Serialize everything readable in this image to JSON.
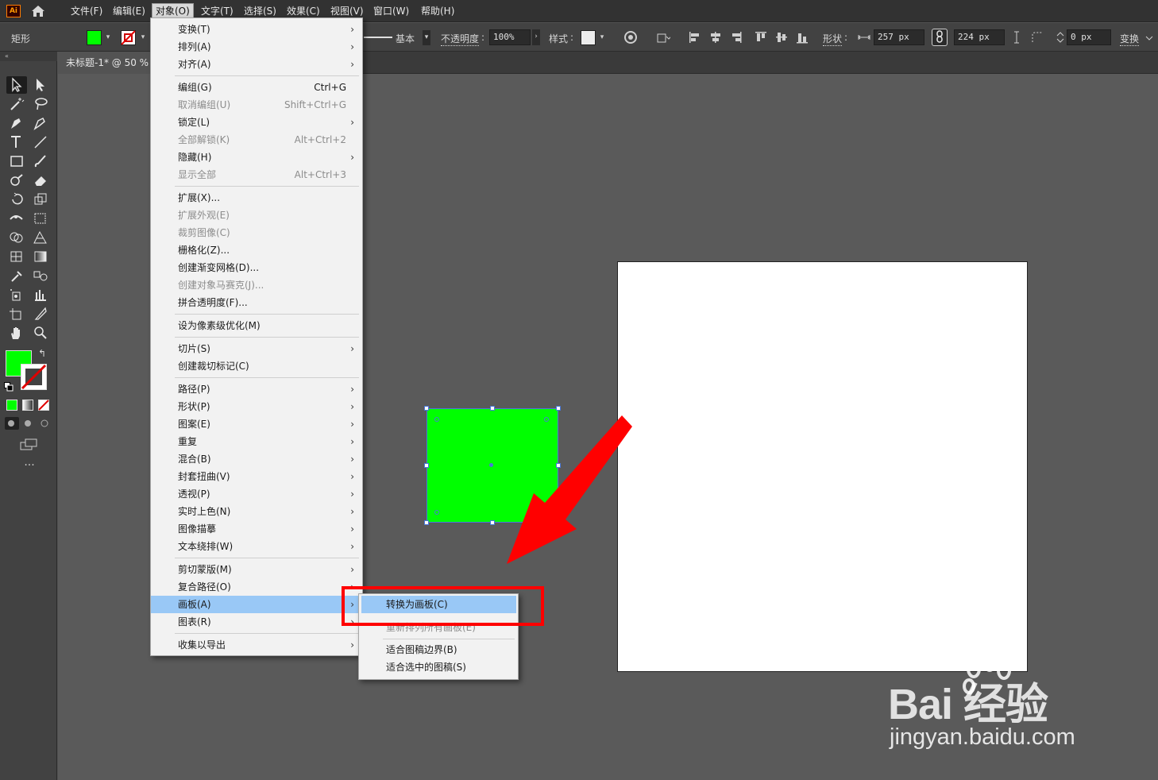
{
  "app": {
    "logo_text": "Ai"
  },
  "menubar": {
    "items": [
      "文件(F)",
      "编辑(E)",
      "对象(O)",
      "文字(T)",
      "选择(S)",
      "效果(C)",
      "视图(V)",
      "窗口(W)",
      "帮助(H)"
    ],
    "active_index": 2
  },
  "controlbar": {
    "tool_name": "矩形",
    "fill_color": "#00ff00",
    "stroke_style": "基本",
    "opacity_label": "不透明度",
    "opacity_value": "100%",
    "style_label": "样式",
    "shape_label": "形状",
    "width_value": "257 px",
    "height_value": "224 px",
    "corner_value": "0 px",
    "transform_label": "变换"
  },
  "document": {
    "tab_title": "未标题-1* @ 50 %"
  },
  "object_menu": {
    "items": [
      {
        "label": "变换(T)",
        "shortcut": "",
        "submenu": true,
        "disabled": false
      },
      {
        "label": "排列(A)",
        "shortcut": "",
        "submenu": true,
        "disabled": false
      },
      {
        "label": "对齐(A)",
        "shortcut": "",
        "submenu": true,
        "disabled": false
      },
      {
        "label": "编组(G)",
        "shortcut": "Ctrl+G",
        "submenu": false,
        "disabled": false
      },
      {
        "label": "取消编组(U)",
        "shortcut": "Shift+Ctrl+G",
        "submenu": false,
        "disabled": true
      },
      {
        "label": "锁定(L)",
        "shortcut": "",
        "submenu": true,
        "disabled": false
      },
      {
        "label": "全部解锁(K)",
        "shortcut": "Alt+Ctrl+2",
        "submenu": false,
        "disabled": true
      },
      {
        "label": "隐藏(H)",
        "shortcut": "",
        "submenu": true,
        "disabled": false
      },
      {
        "label": "显示全部",
        "shortcut": "Alt+Ctrl+3",
        "submenu": false,
        "disabled": true
      },
      {
        "label": "扩展(X)...",
        "shortcut": "",
        "submenu": false,
        "disabled": false
      },
      {
        "label": "扩展外观(E)",
        "shortcut": "",
        "submenu": false,
        "disabled": true
      },
      {
        "label": "裁剪图像(C)",
        "shortcut": "",
        "submenu": false,
        "disabled": true
      },
      {
        "label": "栅格化(Z)...",
        "shortcut": "",
        "submenu": false,
        "disabled": false
      },
      {
        "label": "创建渐变网格(D)...",
        "shortcut": "",
        "submenu": false,
        "disabled": false
      },
      {
        "label": "创建对象马赛克(J)...",
        "shortcut": "",
        "submenu": false,
        "disabled": true
      },
      {
        "label": "拼合透明度(F)...",
        "shortcut": "",
        "submenu": false,
        "disabled": false
      },
      {
        "label": "设为像素级优化(M)",
        "shortcut": "",
        "submenu": false,
        "disabled": false
      },
      {
        "label": "切片(S)",
        "shortcut": "",
        "submenu": true,
        "disabled": false
      },
      {
        "label": "创建裁切标记(C)",
        "shortcut": "",
        "submenu": false,
        "disabled": false
      },
      {
        "label": "路径(P)",
        "shortcut": "",
        "submenu": true,
        "disabled": false
      },
      {
        "label": "形状(P)",
        "shortcut": "",
        "submenu": true,
        "disabled": false
      },
      {
        "label": "图案(E)",
        "shortcut": "",
        "submenu": true,
        "disabled": false
      },
      {
        "label": "重复",
        "shortcut": "",
        "submenu": true,
        "disabled": false
      },
      {
        "label": "混合(B)",
        "shortcut": "",
        "submenu": true,
        "disabled": false
      },
      {
        "label": "封套扭曲(V)",
        "shortcut": "",
        "submenu": true,
        "disabled": false
      },
      {
        "label": "透视(P)",
        "shortcut": "",
        "submenu": true,
        "disabled": false
      },
      {
        "label": "实时上色(N)",
        "shortcut": "",
        "submenu": true,
        "disabled": false
      },
      {
        "label": "图像描摹",
        "shortcut": "",
        "submenu": true,
        "disabled": false
      },
      {
        "label": "文本绕排(W)",
        "shortcut": "",
        "submenu": true,
        "disabled": false
      },
      {
        "label": "剪切蒙版(M)",
        "shortcut": "",
        "submenu": true,
        "disabled": false
      },
      {
        "label": "复合路径(O)",
        "shortcut": "",
        "submenu": true,
        "disabled": false
      },
      {
        "label": "画板(A)",
        "shortcut": "",
        "submenu": true,
        "disabled": false
      },
      {
        "label": "图表(R)",
        "shortcut": "",
        "submenu": true,
        "disabled": false
      },
      {
        "label": "收集以导出",
        "shortcut": "",
        "submenu": true,
        "disabled": false
      }
    ],
    "highlighted_index": 31
  },
  "artboard_submenu": {
    "items": [
      {
        "label": "转换为画板(C)",
        "disabled": false
      },
      {
        "label": "重新排列所有画板(E)",
        "disabled": true
      },
      {
        "label": "适合图稿边界(B)",
        "disabled": false
      },
      {
        "label": "适合选中的图稿(S)",
        "disabled": false
      }
    ],
    "highlighted_index": 0
  },
  "colors": {
    "fill": "#00ff00",
    "annotation_red": "#ff0000",
    "menu_highlight": "#99c8f6",
    "selection_blue": "#4a78d8"
  },
  "watermark": {
    "brand": "Bai 经验",
    "url": "jingyan.baidu.com"
  }
}
